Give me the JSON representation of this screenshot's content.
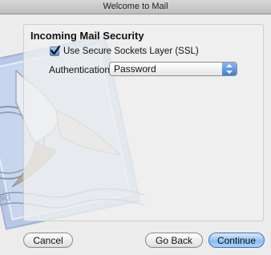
{
  "window": {
    "title": "Welcome to Mail"
  },
  "section": {
    "title": "Incoming Mail Security"
  },
  "ssl": {
    "label": "Use Secure Sockets Layer (SSL)",
    "checked": true
  },
  "authentication": {
    "label": "Authentication:",
    "selected": "Password"
  },
  "buttons": {
    "cancel": "Cancel",
    "go_back": "Go Back",
    "continue": "Continue"
  },
  "icons": {
    "background_art": "mail-stamp-eagle-icon",
    "checkbox": "checkmark-icon",
    "select_arrows": "updown-arrows-icon"
  },
  "colors": {
    "accent": "#4f8fde",
    "default_button": "#8cc0f5"
  }
}
